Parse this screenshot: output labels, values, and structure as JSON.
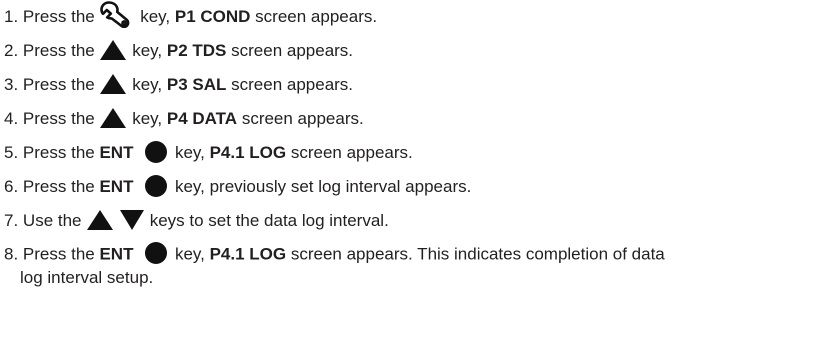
{
  "steps": [
    {
      "number": "1.",
      "pre": "Press the",
      "icon": "wrench-icon",
      "mid": "key,",
      "bold": "P1 COND",
      "post": "screen appears."
    },
    {
      "number": "2.",
      "pre": "Press the",
      "icon": "up-arrow-icon",
      "mid": "key,",
      "bold": "P2 TDS",
      "post": "screen appears."
    },
    {
      "number": "3.",
      "pre": "Press the",
      "icon": "up-arrow-icon",
      "mid": "key,",
      "bold": "P3 SAL",
      "post": "screen appears."
    },
    {
      "number": "4.",
      "pre": "Press the",
      "icon": "up-arrow-icon",
      "mid": "key,",
      "bold": "P4 DATA",
      "post": "screen appears."
    },
    {
      "number": "5.",
      "pre": "Press the",
      "key_label": "ENT",
      "icon": "circle-icon",
      "mid": "key,",
      "bold": "P4.1 LOG",
      "post": "screen appears."
    },
    {
      "number": "6.",
      "pre": "Press the",
      "key_label": "ENT",
      "icon": "circle-icon",
      "post": "key, previously set log interval appears."
    },
    {
      "number": "7.",
      "pre": "Use the",
      "icons": [
        "up-arrow-icon",
        "down-arrow-icon"
      ],
      "post": "keys to set the data log interval."
    },
    {
      "number": "8.",
      "pre": "Press the",
      "key_label": "ENT",
      "icon": "circle-icon",
      "mid": "key,",
      "bold": "P4.1 LOG",
      "post": "screen appears. This indicates completion of data",
      "continuation": "log interval setup."
    }
  ],
  "colors": {
    "text": "#231f20",
    "icon": "#111111"
  }
}
